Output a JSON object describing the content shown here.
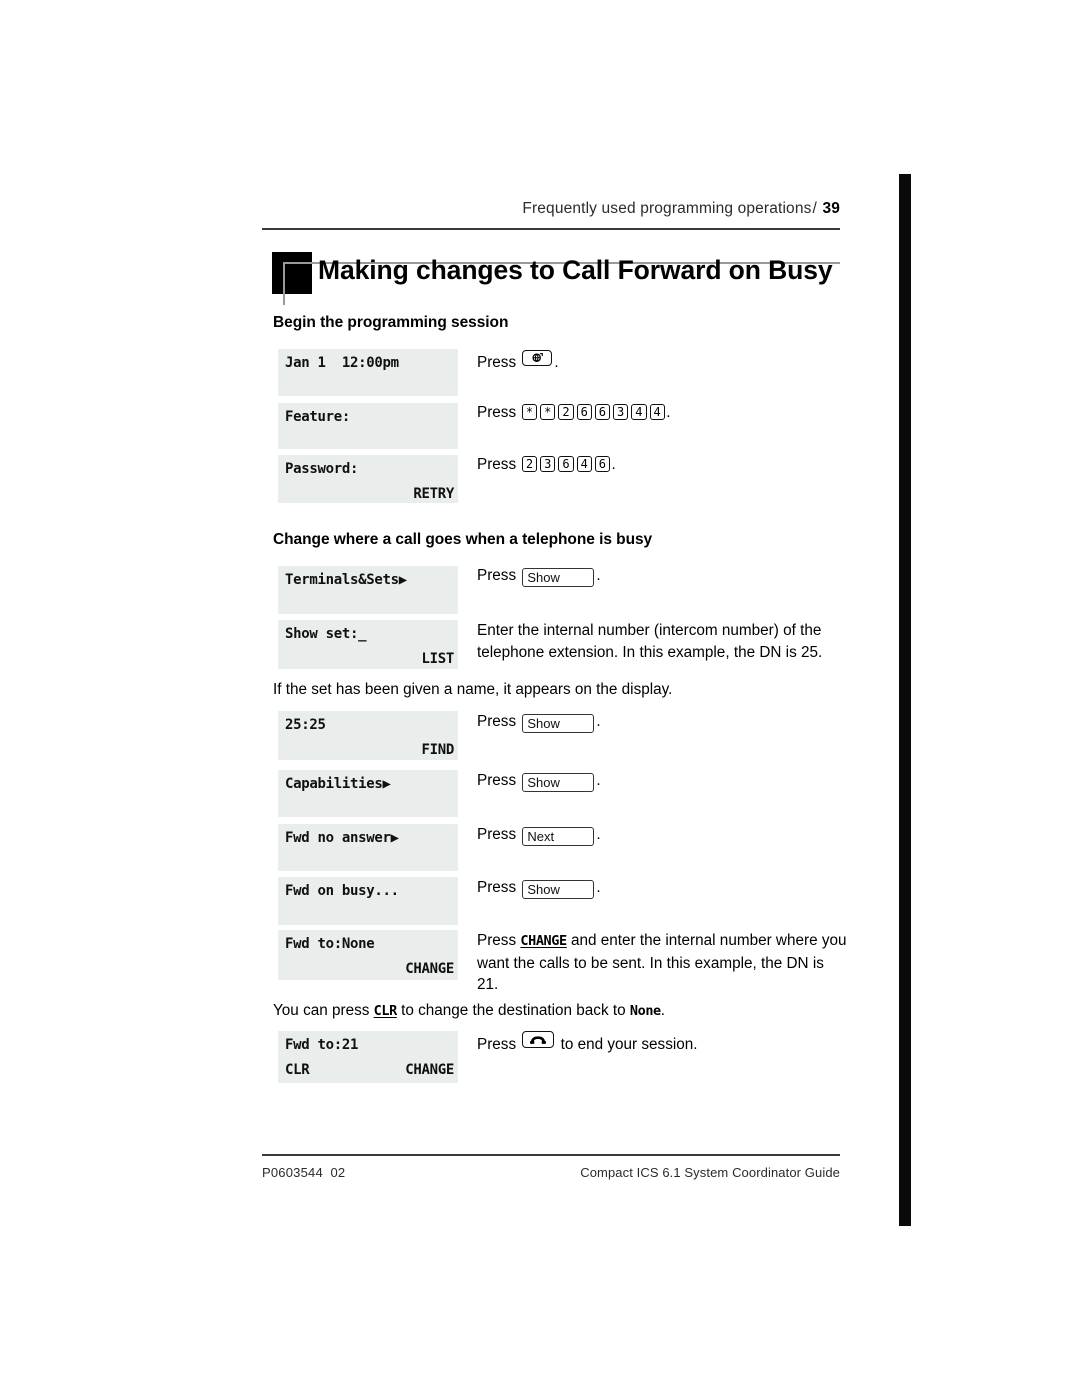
{
  "header": {
    "running_head": "Frequently used programming operations",
    "separator": "/",
    "page_number": "39"
  },
  "title": "Making changes to Call Forward on Busy",
  "sections": [
    {
      "heading": "Begin the programming session"
    },
    {
      "heading": "Change where a call goes when a telephone is busy"
    }
  ],
  "steps": [
    {
      "id": "step-datetime",
      "lcd_line1": "Jan 1  12:00pm",
      "lcd_line2": "",
      "instruction_prefix": "Press",
      "keys": [
        "feature"
      ],
      "instruction_suffix": "."
    },
    {
      "id": "step-feature",
      "lcd_line1": "Feature:",
      "lcd_line2": "",
      "instruction_prefix": "Press",
      "keys": [
        "*",
        "*",
        "2",
        "6",
        "6",
        "3",
        "4",
        "4"
      ],
      "instruction_suffix": "."
    },
    {
      "id": "step-password",
      "lcd_line1": "Password:",
      "lcd_line2_right": "RETRY",
      "instruction_prefix": "Press",
      "keys": [
        "2",
        "3",
        "6",
        "4",
        "6"
      ],
      "instruction_suffix": "."
    },
    {
      "id": "step-terminals-sets",
      "lcd_line1": "Terminals&Sets▶",
      "lcd_line2": "",
      "instruction_prefix": "Press",
      "softkey": "Show",
      "instruction_suffix": "."
    },
    {
      "id": "step-show-set",
      "lcd_line1": "Show set:_",
      "lcd_line2_right": "LIST",
      "instruction_text": "Enter the internal number (intercom number) of the telephone extension. In this example, the DN is 25."
    },
    {
      "id": "step-dn-2525",
      "lcd_line1": "25:25",
      "lcd_line2_right": "FIND",
      "instruction_prefix": "Press",
      "softkey": "Show",
      "instruction_suffix": "."
    },
    {
      "id": "step-capabilities",
      "lcd_line1": "Capabilities▶",
      "lcd_line2": "",
      "instruction_prefix": "Press",
      "softkey": "Show",
      "instruction_suffix": "."
    },
    {
      "id": "step-fwd-no-answer",
      "lcd_line1": "Fwd no answer▶",
      "lcd_line2": "",
      "instruction_prefix": "Press",
      "softkey": "Next",
      "instruction_suffix": "."
    },
    {
      "id": "step-fwd-on-busy",
      "lcd_line1": "Fwd on busy...",
      "lcd_line2": "",
      "instruction_prefix": "Press",
      "softkey": "Show",
      "instruction_suffix": "."
    },
    {
      "id": "step-fwd-to-none",
      "lcd_line1": "Fwd to:None",
      "lcd_line2_right": "CHANGE"
    },
    {
      "id": "step-fwd-to-21",
      "lcd_line1": "Fwd to:21",
      "lcd_line2_left": "CLR",
      "lcd_line2_right": "CHANGE"
    }
  ],
  "paragraphs": {
    "name_on_display": "If the set has been given a name, it appears on the display.",
    "change_instruction_a": "Press",
    "change_instruction_key": "CHANGE",
    "change_instruction_b": "and enter the internal number where you want the calls to be sent. In this example, the DN is 21.",
    "clr_a": "You can press",
    "clr_key": "CLR",
    "clr_b": "to change the destination back to",
    "clr_value": "None",
    "clr_end": ".",
    "end_session_a": "Press",
    "end_session_b": "to end your session."
  },
  "footer": {
    "left": "P0603544  02",
    "right": "Compact ICS 6.1 System Coordinator Guide"
  },
  "icons": {
    "feature_key": "feature-key-icon",
    "release_key": "release-handset-icon"
  }
}
